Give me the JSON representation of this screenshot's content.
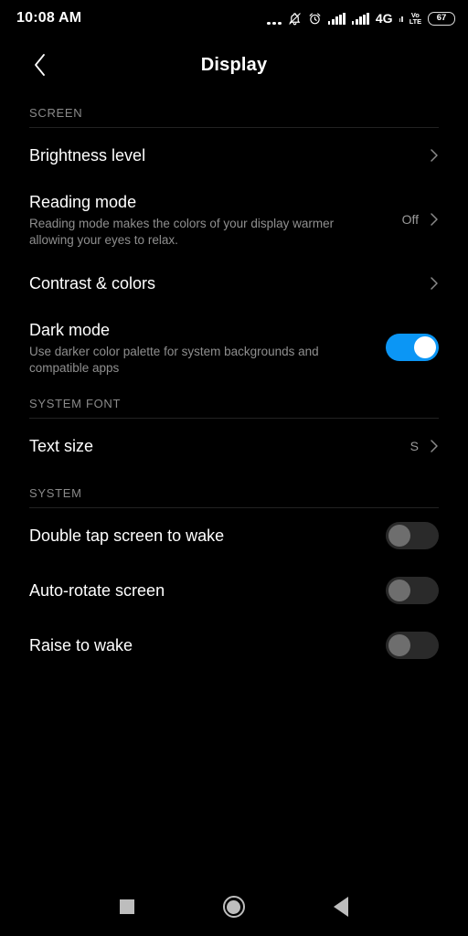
{
  "status_bar": {
    "clock": "10:08 AM",
    "icons": {
      "overflow_dots": "more-dots",
      "bell_muted": "bell-muted",
      "alarm": "alarm-clock",
      "signal_1": "signal-bars",
      "signal_2": "signal-bars",
      "network_type": "4G",
      "roaming_bars": "mini-signal",
      "volte_top": "Vo",
      "volte_bottom": "LTE",
      "battery_level": "67"
    }
  },
  "appbar": {
    "back_icon": "back-chevron",
    "title": "Display"
  },
  "sections": [
    {
      "header": "SCREEN",
      "rows": [
        {
          "title": "Brightness level",
          "subtitle": "",
          "value": "",
          "control": "chevron"
        },
        {
          "title": "Reading mode",
          "subtitle": "Reading mode makes the colors of your display warmer allowing your eyes to relax.",
          "value": "Off",
          "control": "chevron"
        },
        {
          "title": "Contrast & colors",
          "subtitle": "",
          "value": "",
          "control": "chevron"
        },
        {
          "title": "Dark mode",
          "subtitle": "Use darker color palette for system backgrounds and compatible apps",
          "value": "",
          "control": "switch-on"
        }
      ]
    },
    {
      "header": "SYSTEM FONT",
      "rows": [
        {
          "title": "Text size",
          "subtitle": "",
          "value": "S",
          "control": "chevron"
        }
      ]
    },
    {
      "header": "SYSTEM",
      "rows": [
        {
          "title": "Double tap screen to wake",
          "subtitle": "",
          "value": "",
          "control": "switch-off"
        },
        {
          "title": "Auto-rotate screen",
          "subtitle": "",
          "value": "",
          "control": "switch-off"
        },
        {
          "title": "Raise to wake",
          "subtitle": "",
          "value": "",
          "control": "switch-off"
        }
      ]
    }
  ],
  "navbar": {
    "recents": "square-recents-icon",
    "home": "circle-home-icon",
    "back": "triangle-back-icon"
  },
  "colors": {
    "background": "#000000",
    "switch_on": "#0b96f5",
    "switch_off_track": "#2a2a2a",
    "switch_off_knob": "#6e6e6e",
    "divider": "#222222",
    "text_primary": "#ffffff",
    "text_secondary": "#8f8f8f"
  }
}
